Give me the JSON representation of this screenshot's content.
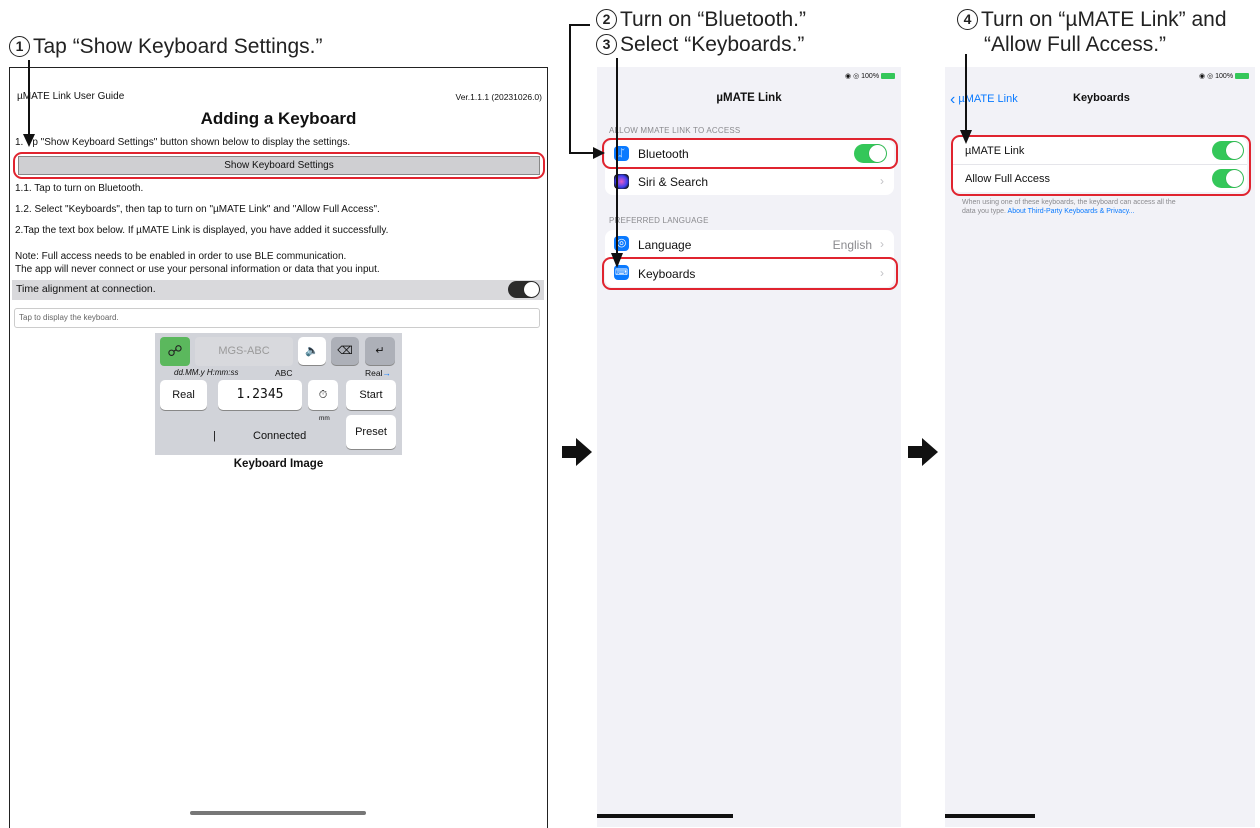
{
  "steps": {
    "s1": {
      "num": "1",
      "text": "Tap “Show Keyboard Settings.”"
    },
    "s2": {
      "num": "2",
      "text": "Turn on “Bluetooth.”"
    },
    "s3": {
      "num": "3",
      "text": "Select “Keyboards.”"
    },
    "s4": {
      "num": "4",
      "line1": "Turn on “µMATE Link” and",
      "line2": "“Allow Full Access.”"
    }
  },
  "app": {
    "title": "µMATE Link User  Guide",
    "version": "Ver.1.1.1 (20231026.0)",
    "heading": "Adding a Keyboard",
    "line1_prefix": "1.",
    "line1_rest": "p \"Show Keyboard Settings\" button shown below to display the settings.",
    "show_button": "Show Keyboard Settings",
    "line_11": "1.1. Tap to turn on Bluetooth.",
    "line_12": "1.2. Select \"Keyboards\", then tap to turn on \"µMATE Link\" and \"Allow Full Access\".",
    "line_2": "2.Tap the text box below. If µMATE Link is displayed, you have added it successfully.",
    "note1": "Note: Full access needs to be enabled in order to use BLE communication.",
    "note2": "The app will never connect or use your personal information or data that you  input.",
    "time_align": "Time alignment at connection.",
    "time_align_on": false,
    "text_placeholder": "Tap to display the keyboard.",
    "keyboard": {
      "device": "MGS-ABC",
      "date_format": "dd.MM.y H:mm:ss",
      "abc": "ABC",
      "real_arrow": "Real",
      "real_btn": "Real",
      "value": "1.2345",
      "start": "Start",
      "unit": "mm",
      "cursor": "|",
      "status": "Connected",
      "preset": "Preset"
    },
    "kb_caption": "Keyboard Image"
  },
  "settings": {
    "status_right": "100%",
    "title": "µMATE Link",
    "section1": "ALLOW MMATE LINK TO ACCESS",
    "bluetooth": "Bluetooth",
    "bluetooth_on": true,
    "siri": "Siri & Search",
    "section2": "PREFERRED LANGUAGE",
    "language": "Language",
    "language_value": "English",
    "keyboards": "Keyboards"
  },
  "keyboards_screen": {
    "status_right": "100%",
    "back": "µMATE Link",
    "title": "Keyboards",
    "umate": "µMATE Link",
    "umate_on": true,
    "full_access": "Allow Full Access",
    "full_access_on": true,
    "footnote_a": "When using one of these keyboards, the keyboard can access all the",
    "footnote_b": "data you type.",
    "footnote_link": "About Third-Party Keyboards & Privacy..."
  },
  "colors": {
    "highlight": "#e0242f",
    "toggle_on": "#34c759",
    "ios_blue": "#0a7aff",
    "ios_bg": "#f2f2f7"
  }
}
